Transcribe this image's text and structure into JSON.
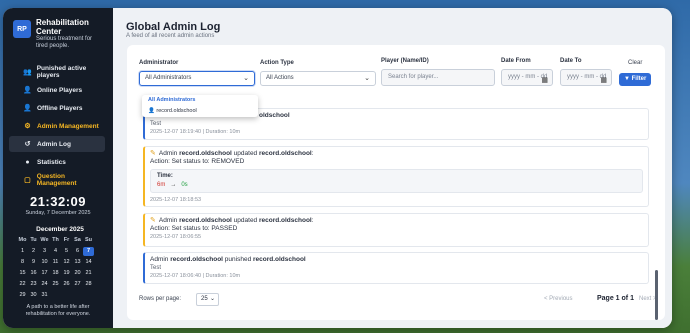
{
  "brand": {
    "logo": "RP",
    "title": "Rehabilitation Center",
    "subtitle": "Serious treatment for tired people."
  },
  "nav": {
    "items": [
      {
        "label": "Punished active players",
        "icon": "users-icon"
      },
      {
        "label": "Online Players",
        "icon": "user-icon"
      },
      {
        "label": "Offline Players",
        "icon": "user-icon"
      },
      {
        "label": "Admin Management",
        "icon": "admin-icon"
      },
      {
        "label": "Admin Log",
        "icon": "history-icon"
      },
      {
        "label": "Statistics",
        "icon": "chart-icon"
      },
      {
        "label": "Question Management",
        "icon": "folder-icon"
      }
    ]
  },
  "clock": {
    "time": "21:32:09",
    "date": "Sunday, 7 December 2025"
  },
  "calendar": {
    "title": "December 2025",
    "headers": [
      "Mo",
      "Tu",
      "We",
      "Th",
      "Fr",
      "Sa",
      "Su"
    ],
    "days": [
      "1",
      "2",
      "3",
      "4",
      "5",
      "6",
      "7",
      "8",
      "9",
      "10",
      "11",
      "12",
      "13",
      "14",
      "15",
      "16",
      "17",
      "18",
      "19",
      "20",
      "21",
      "22",
      "23",
      "24",
      "25",
      "26",
      "27",
      "28",
      "29",
      "30",
      "31"
    ],
    "today": "7"
  },
  "tagline": "A path to a better life after rehabilitation for everyone.",
  "header": {
    "title": "Global Admin Log",
    "subtitle": "A feed of all recent admin actions"
  },
  "filters": {
    "admin_label": "Administrator",
    "admin_value": "All Administrators",
    "action_label": "Action Type",
    "action_value": "All Actions",
    "player_label": "Player (Name/ID)",
    "player_placeholder": "Search for player...",
    "date_from_label": "Date From",
    "date_from_value": "yyyy - mm - dd",
    "date_to_label": "Date To",
    "date_to_value": "yyyy - mm - dd",
    "clear_label": "Clear",
    "filter_label": "Filter"
  },
  "dropdown": {
    "items": [
      "All Administrators",
      "record.oldschool"
    ]
  },
  "entries": [
    {
      "line_tail": "oldschool",
      "sub": "Test",
      "meta": "2025-12-07 18:19:40 | Duration: 10m"
    },
    {
      "prefix": "Admin",
      "admin": "record.oldschool",
      "verb": "updated",
      "target": "record.oldschool",
      "action": "Action: Set status to: REMOVED",
      "time_label": "Time:",
      "old": "6m",
      "new": "0s",
      "meta": "2025-12-07 18:18:53"
    },
    {
      "prefix": "Admin",
      "admin": "record.oldschool",
      "verb": "updated",
      "target": "record.oldschool",
      "action": "Action: Set status to: PASSED",
      "meta": "2025-12-07 18:06:55"
    },
    {
      "prefix": "Admin",
      "admin": "record.oldschool",
      "verb": "punished",
      "target": "record.oldschool",
      "sub": "Test",
      "meta": "2025-12-07 18:06:40 | Duration: 10m"
    }
  ],
  "pager": {
    "rows_label": "Rows per page:",
    "rows_value": "25",
    "prev": "< Previous",
    "page": "Page 1 of 1",
    "next": "Next >"
  },
  "colors": {
    "accent": "#2f6bd6",
    "gold": "#f5b623",
    "sidebar": "#141b26"
  }
}
